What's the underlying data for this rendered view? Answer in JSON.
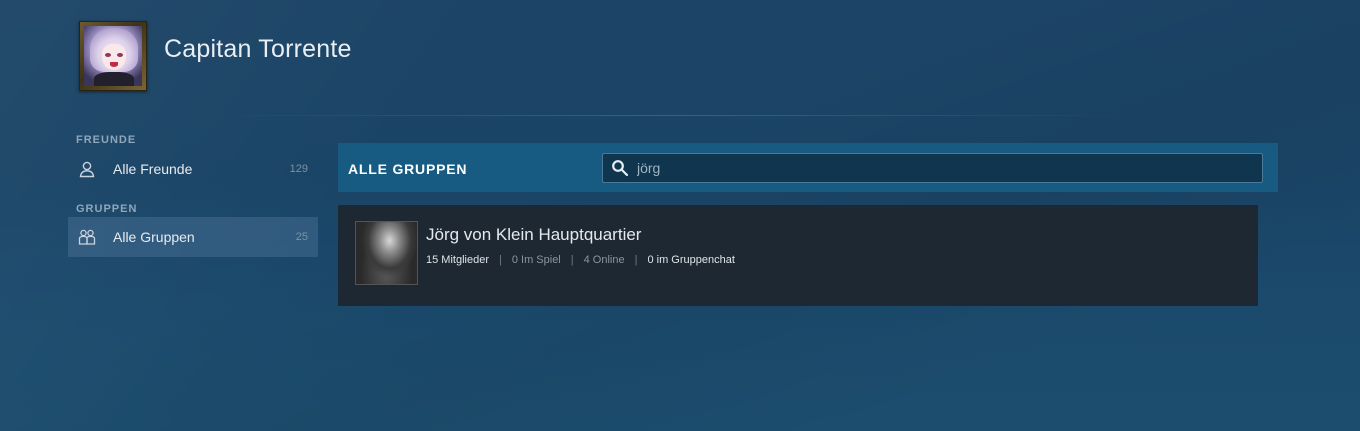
{
  "profile": {
    "name": "Capitan Torrente",
    "avatar_icon": "anime-avatar"
  },
  "sidebar": {
    "sections": [
      {
        "header": "FREUNDE",
        "items": [
          {
            "label": "Alle Freunde",
            "count": "129",
            "icon": "person-icon",
            "active": false
          }
        ]
      },
      {
        "header": "GRUPPEN",
        "items": [
          {
            "label": "Alle Gruppen",
            "count": "25",
            "icon": "group-icon",
            "active": true
          }
        ]
      }
    ]
  },
  "groups_panel": {
    "title": "ALLE GRUPPEN",
    "search": {
      "value": "jörg",
      "placeholder": ""
    },
    "results": [
      {
        "name": "Jörg von Klein Hauptquartier",
        "members": "15 Mitglieder",
        "in_game": "0 Im Spiel",
        "online": "4 Online",
        "in_chat": "0 im Gruppenchat"
      }
    ]
  },
  "colors": {
    "background": "#1b4566",
    "panel_bar": "#175b82",
    "card": "#1e2832",
    "active_item": "#3d6a8c"
  }
}
